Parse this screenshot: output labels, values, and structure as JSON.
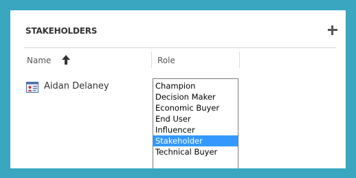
{
  "section": {
    "title": "STAKEHOLDERS"
  },
  "columns": {
    "name": "Name",
    "role": "Role"
  },
  "row": {
    "name": "Aidan Delaney"
  },
  "role_options": [
    "Champion",
    "Decision Maker",
    "Economic Buyer",
    "End User",
    "Influencer",
    "Stakeholder",
    "Technical Buyer"
  ],
  "selected_role": "Stakeholder",
  "colors": {
    "frame": "#3aa6c0",
    "selection": "#3399ff"
  },
  "icons": {
    "add": "plus-icon",
    "sort": "sort-ascending-arrow-icon",
    "contact": "contact-card-icon"
  }
}
